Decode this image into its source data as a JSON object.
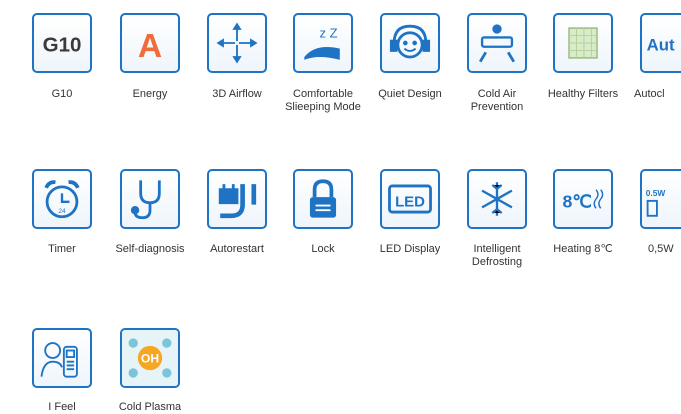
{
  "features": [
    {
      "label": "G10",
      "icon": "g10-badge-icon",
      "icon_text": "G10"
    },
    {
      "label": "Energy",
      "icon": "energy-class-a-icon",
      "icon_text": "A"
    },
    {
      "label": "3D Airflow",
      "icon": "airflow-arrows-icon"
    },
    {
      "label": "Comfortable Slieeping Mode",
      "icon": "sleep-zzz-icon",
      "icon_text": "z Z"
    },
    {
      "label": "Quiet Design",
      "icon": "headphones-face-icon"
    },
    {
      "label": "Cold Air Prevention",
      "icon": "ac-unit-sun-icon"
    },
    {
      "label": "Healthy Filters",
      "icon": "filter-screen-icon"
    },
    {
      "label": "Autocl",
      "icon": "auto-clean-icon",
      "icon_text": "Aut"
    },
    {
      "label": "Timer",
      "icon": "alarm-clock-icon",
      "icon_text": "24"
    },
    {
      "label": "Self-diagnosis",
      "icon": "stethoscope-icon"
    },
    {
      "label": "Autorestart",
      "icon": "plug-restart-icon"
    },
    {
      "label": "Lock",
      "icon": "padlock-icon"
    },
    {
      "label": "LED Display",
      "icon": "led-display-icon",
      "icon_text": "LED"
    },
    {
      "label": "Intelligent Defrosting",
      "icon": "snowflake-icon"
    },
    {
      "label": "Heating 8℃",
      "icon": "heating-8c-icon",
      "icon_text": "8℃"
    },
    {
      "label": "0,5W",
      "icon": "standby-power-icon",
      "icon_text": "0.5W"
    },
    {
      "label": "I Feel",
      "icon": "remote-person-icon"
    },
    {
      "label": "Cold Plasma",
      "icon": "cold-plasma-icon",
      "icon_text": "OH"
    }
  ],
  "colors": {
    "border": "#1e73c4",
    "text": "#333333",
    "accent": "#1e73c4",
    "energy": "#f26b3a",
    "g10": "#c0392b"
  }
}
